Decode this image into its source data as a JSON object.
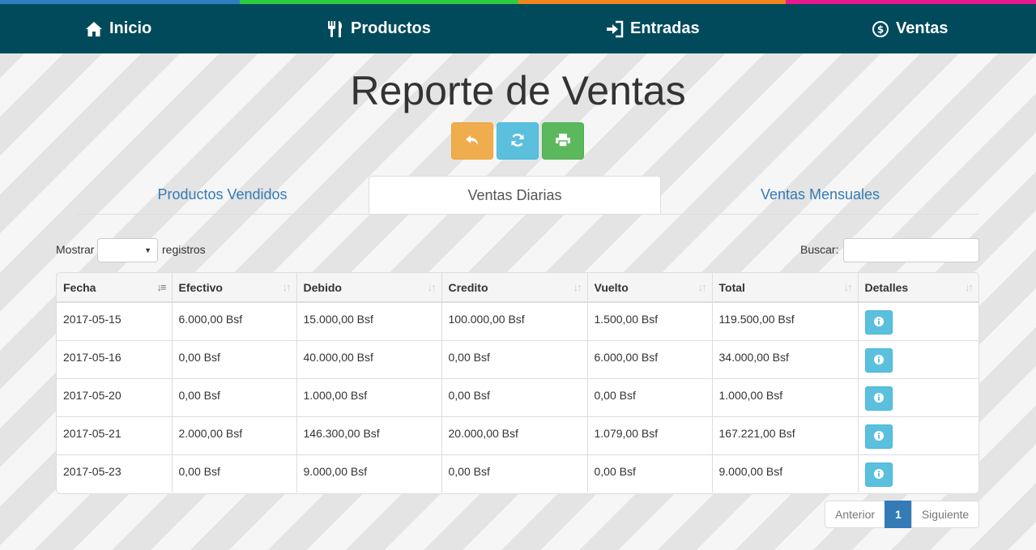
{
  "nav": {
    "stripe_colors": [
      "#2f7fc0",
      "#2ecc40",
      "#f0851f",
      "#e8198c"
    ],
    "items": [
      {
        "label": "Inicio",
        "icon": "home-icon"
      },
      {
        "label": "Productos",
        "icon": "cutlery-icon"
      },
      {
        "label": "Entradas",
        "icon": "sign-in-icon"
      },
      {
        "label": "Ventas",
        "icon": "dollar-circle-icon"
      }
    ]
  },
  "page": {
    "title": "Reporte de Ventas",
    "buttons": [
      {
        "icon": "back-arrow-icon",
        "color": "#f0ad4e"
      },
      {
        "icon": "refresh-icon",
        "color": "#5bc0de"
      },
      {
        "icon": "print-icon",
        "color": "#5cb85c"
      }
    ]
  },
  "tabs": [
    {
      "label": "Productos Vendidos",
      "active": false
    },
    {
      "label": "Ventas Diarias",
      "active": true
    },
    {
      "label": "Ventas Mensuales",
      "active": false
    }
  ],
  "table_controls": {
    "show_label": "Mostrar",
    "show_value": "",
    "records_label": "registros",
    "search_label": "Buscar:",
    "search_value": ""
  },
  "table": {
    "columns": [
      "Fecha",
      "Efectivo",
      "Debido",
      "Credito",
      "Vuelto",
      "Total",
      "Detalles"
    ],
    "sorted_column": "Fecha",
    "rows": [
      [
        "2017-05-15",
        "6.000,00 Bsf",
        "15.000,00 Bsf",
        "100.000,00 Bsf",
        "1.500,00 Bsf",
        "119.500,00 Bsf"
      ],
      [
        "2017-05-16",
        "0,00 Bsf",
        "40.000,00 Bsf",
        "0,00 Bsf",
        "6.000,00 Bsf",
        "34.000,00 Bsf"
      ],
      [
        "2017-05-20",
        "0,00 Bsf",
        "1.000,00 Bsf",
        "0,00 Bsf",
        "0,00 Bsf",
        "1.000,00 Bsf"
      ],
      [
        "2017-05-21",
        "2.000,00 Bsf",
        "146.300,00 Bsf",
        "20.000,00 Bsf",
        "1.079,00 Bsf",
        "167.221,00 Bsf"
      ],
      [
        "2017-05-23",
        "0,00 Bsf",
        "9.000,00 Bsf",
        "0,00 Bsf",
        "0,00 Bsf",
        "9.000,00 Bsf"
      ]
    ],
    "details_icon": "info-icon"
  },
  "pagination": {
    "prev": "Anterior",
    "current": "1",
    "next": "Siguiente"
  }
}
